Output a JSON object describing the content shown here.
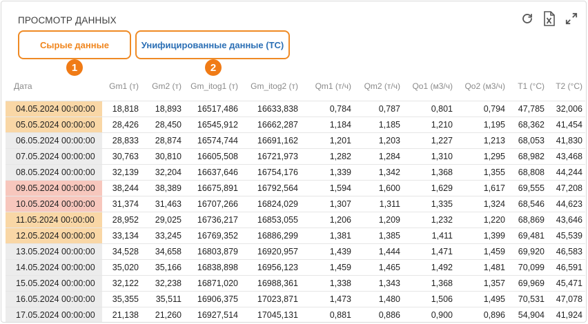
{
  "panel": {
    "title": "ПРОСМОТР ДАННЫХ"
  },
  "toolbar": {
    "refresh_icon": "refresh-icon",
    "excel_icon": "excel-export-icon",
    "expand_icon": "expand-icon"
  },
  "tabs": [
    {
      "label": "Сырые данные",
      "badge": "1"
    },
    {
      "label": "Унифицированные данные (ТС)",
      "badge": "2"
    }
  ],
  "colors": {
    "accent_orange": "#ef8a24",
    "link_blue": "#2b6fb5",
    "row_orange": "#f9d7a6",
    "row_red": "#f7c7bd",
    "row_gray": "#ececec"
  },
  "table": {
    "headers": [
      "Дата",
      "Gm1 (т)",
      "Gm2 (т)",
      "Gm_itog1 (т)",
      "Gm_itog2 (т)",
      "Qm1 (т/ч)",
      "Qm2 (т/ч)",
      "Qo1 (м3/ч)",
      "Qo2 (м3/ч)",
      "T1 (°C)",
      "T2 (°C)"
    ],
    "rows": [
      {
        "status": "orange",
        "cells": [
          "04.05.2024 00:00:00",
          "18,818",
          "18,893",
          "16517,486",
          "16633,838",
          "0,784",
          "0,787",
          "0,801",
          "0,794",
          "47,785",
          "32,006"
        ]
      },
      {
        "status": "orange",
        "cells": [
          "05.05.2024 00:00:00",
          "28,426",
          "28,450",
          "16545,912",
          "16662,287",
          "1,184",
          "1,185",
          "1,210",
          "1,195",
          "68,362",
          "41,454"
        ]
      },
      {
        "status": "gray",
        "cells": [
          "06.05.2024 00:00:00",
          "28,833",
          "28,874",
          "16574,744",
          "16691,162",
          "1,201",
          "1,203",
          "1,227",
          "1,213",
          "68,053",
          "41,830"
        ]
      },
      {
        "status": "gray",
        "cells": [
          "07.05.2024 00:00:00",
          "30,763",
          "30,810",
          "16605,508",
          "16721,973",
          "1,282",
          "1,284",
          "1,310",
          "1,295",
          "68,982",
          "43,468"
        ]
      },
      {
        "status": "gray",
        "cells": [
          "08.05.2024 00:00:00",
          "32,139",
          "32,204",
          "16637,646",
          "16754,176",
          "1,339",
          "1,342",
          "1,368",
          "1,355",
          "68,808",
          "44,244"
        ]
      },
      {
        "status": "red",
        "cells": [
          "09.05.2024 00:00:00",
          "38,244",
          "38,389",
          "16675,891",
          "16792,564",
          "1,594",
          "1,600",
          "1,629",
          "1,617",
          "69,555",
          "47,208"
        ]
      },
      {
        "status": "red",
        "cells": [
          "10.05.2024 00:00:00",
          "31,374",
          "31,463",
          "16707,266",
          "16824,029",
          "1,307",
          "1,311",
          "1,335",
          "1,324",
          "68,546",
          "44,623"
        ]
      },
      {
        "status": "orange",
        "cells": [
          "11.05.2024 00:00:00",
          "28,952",
          "29,025",
          "16736,217",
          "16853,055",
          "1,206",
          "1,209",
          "1,232",
          "1,220",
          "68,869",
          "43,646"
        ]
      },
      {
        "status": "orange",
        "cells": [
          "12.05.2024 00:00:00",
          "33,134",
          "33,245",
          "16769,352",
          "16886,299",
          "1,381",
          "1,385",
          "1,411",
          "1,399",
          "69,481",
          "45,539"
        ]
      },
      {
        "status": "gray",
        "cells": [
          "13.05.2024 00:00:00",
          "34,528",
          "34,658",
          "16803,879",
          "16920,957",
          "1,439",
          "1,444",
          "1,471",
          "1,459",
          "69,920",
          "46,583"
        ]
      },
      {
        "status": "gray",
        "cells": [
          "14.05.2024 00:00:00",
          "35,020",
          "35,166",
          "16838,898",
          "16956,123",
          "1,459",
          "1,465",
          "1,492",
          "1,481",
          "70,099",
          "46,591"
        ]
      },
      {
        "status": "gray",
        "cells": [
          "15.05.2024 00:00:00",
          "32,122",
          "32,238",
          "16871,020",
          "16988,361",
          "1,338",
          "1,343",
          "1,368",
          "1,357",
          "69,969",
          "45,471"
        ]
      },
      {
        "status": "gray",
        "cells": [
          "16.05.2024 00:00:00",
          "35,355",
          "35,511",
          "16906,375",
          "17023,871",
          "1,473",
          "1,480",
          "1,506",
          "1,495",
          "70,531",
          "47,078"
        ]
      },
      {
        "status": "gray",
        "cells": [
          "17.05.2024 00:00:00",
          "21,138",
          "21,260",
          "16927,514",
          "17045,131",
          "0,881",
          "0,886",
          "0,900",
          "0,896",
          "54,904",
          "41,924"
        ]
      }
    ]
  }
}
